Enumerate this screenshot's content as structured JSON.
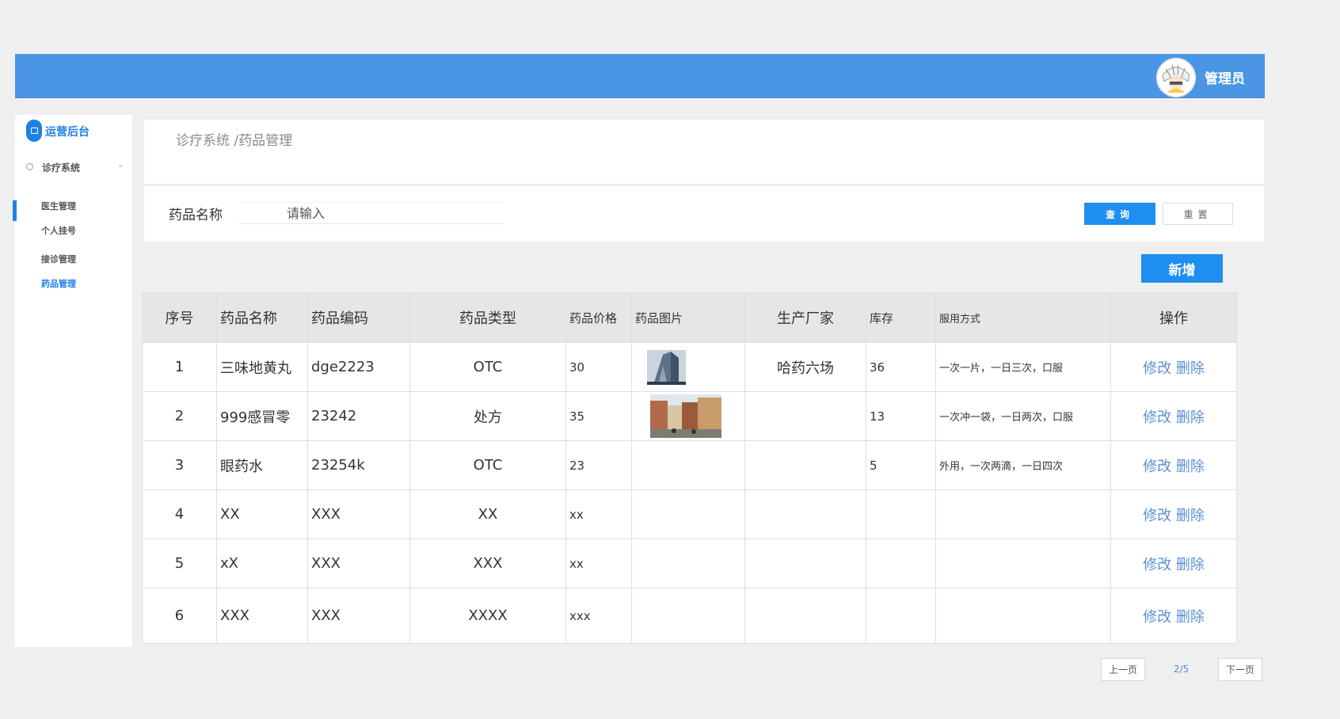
{
  "header": {
    "admin_label": "管理员"
  },
  "sidebar": {
    "brand": "运营后台",
    "group": "诊疗系统",
    "items": [
      {
        "label": "医生管理"
      },
      {
        "label": "个人挂号"
      },
      {
        "label": "接诊管理"
      },
      {
        "label": "药品管理"
      }
    ]
  },
  "breadcrumb": "诊疗系统 /药品管理",
  "search": {
    "label": "药品名称",
    "placeholder": "请输入",
    "query_label": "查询",
    "reset_label": "重置"
  },
  "add_label": "新增",
  "table": {
    "headers": [
      "序号",
      "药品名称",
      "药品编码",
      "药品类型",
      "药品价格",
      "药品图片",
      "生产厂家",
      "库存",
      "服用方式",
      "操作"
    ],
    "rows": [
      {
        "no": "1",
        "name": "三味地黄丸",
        "code": "dge2223",
        "type": "OTC",
        "price": "30",
        "maker": "哈药六场",
        "stock": "36",
        "usage": "一次一片，一日三次，口服",
        "edit": "修改",
        "del": "删除"
      },
      {
        "no": "2",
        "name": "999感冒零",
        "code": "23242",
        "type": "处方",
        "price": "35",
        "maker": "",
        "stock": "13",
        "usage": "一次冲一袋，一日两次，口服",
        "edit": "修改",
        "del": "删除"
      },
      {
        "no": "3",
        "name": "眼药水",
        "code": "23254k",
        "type": "OTC",
        "price": "23",
        "maker": "",
        "stock": "5",
        "usage": "外用，一次两滴，一日四次",
        "edit": "修改",
        "del": "删除"
      },
      {
        "no": "4",
        "name": "XX",
        "code": "XXX",
        "type": "XX",
        "price": "xx",
        "maker": "",
        "stock": "",
        "usage": "",
        "edit": "修改",
        "del": "删除"
      },
      {
        "no": "5",
        "name": "xX",
        "code": "XXX",
        "type": "XXX",
        "price": "xx",
        "maker": "",
        "stock": "",
        "usage": "",
        "edit": "修改",
        "del": "删除"
      },
      {
        "no": "6",
        "name": "XXX",
        "code": "XXX",
        "type": "XXXX",
        "price": "xxx",
        "maker": "",
        "stock": "",
        "usage": "",
        "edit": "修改",
        "del": "删除"
      }
    ]
  },
  "pager": {
    "prev": "上一页",
    "info": "2/5",
    "next": "下一页"
  }
}
